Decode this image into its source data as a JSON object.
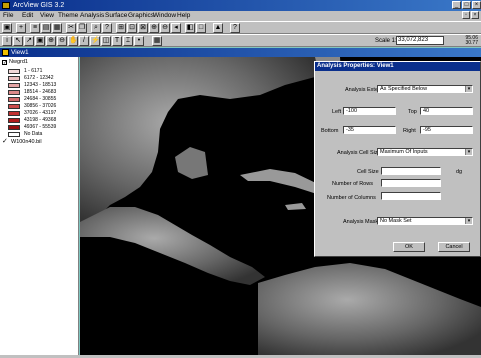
{
  "app": {
    "title": "ArcView GIS 3.2"
  },
  "menu": [
    "File",
    "Edit",
    "View",
    "Theme",
    "Analysis",
    "Surface",
    "Graphics",
    "Window",
    "Help"
  ],
  "scale": {
    "label": "Scale 1:",
    "value": "33,072,823",
    "x": "95.06",
    "y": "30.77"
  },
  "view": {
    "title": "View1"
  },
  "legend": {
    "theme_name": "Nwgrd1",
    "items": [
      {
        "label": "1 - 6171",
        "color": "#f2d8d8"
      },
      {
        "label": "6172 - 12342",
        "color": "#ecc0c0"
      },
      {
        "label": "12343 - 18513",
        "color": "#e4a4a4"
      },
      {
        "label": "18514 - 24683",
        "color": "#dc8888"
      },
      {
        "label": "24684 - 30855",
        "color": "#d46a6a"
      },
      {
        "label": "30856 - 37026",
        "color": "#cc4c4c"
      },
      {
        "label": "37026 - 43197",
        "color": "#c03030"
      },
      {
        "label": "43198 - 49368",
        "color": "#b01c1c"
      },
      {
        "label": "49367 - 55539",
        "color": "#981010"
      },
      {
        "label": "No Data",
        "color": "#ffffff"
      }
    ],
    "second_theme": "W100n40.bil"
  },
  "dialog": {
    "title": "Analysis Properties: View1",
    "extent_label": "Analysis Extent",
    "extent_value": "As Specified Below",
    "left_label": "Left",
    "left_value": "-100",
    "top_label": "Top",
    "top_value": "40",
    "bottom_label": "Bottom",
    "bottom_value": "-35",
    "right_label": "Right",
    "right_value": "-95",
    "cellsize_label": "Analysis Cell Size",
    "cellsize_value": "Maximum Of Inputs",
    "cell_size_label": "Cell Size",
    "cell_size_unit": "dg",
    "rows_label": "Number of Rows",
    "cols_label": "Number of Columns",
    "mask_label": "Analysis Mask",
    "mask_value": "No Mask Set",
    "ok_label": "OK",
    "cancel_label": "Cancel"
  }
}
